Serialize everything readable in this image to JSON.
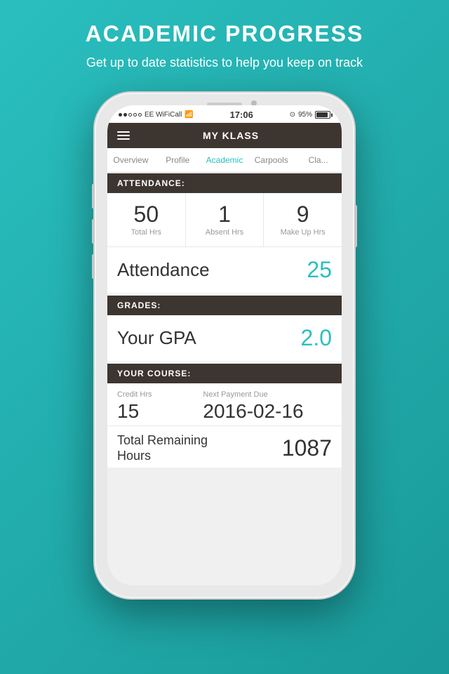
{
  "page": {
    "title": "ACADEMIC PROGRESS",
    "subtitle": "Get up to date statistics to help you keep on track"
  },
  "status_bar": {
    "carrier": "●●○○○ EE WiFiCall",
    "wifi": "WiFiCall",
    "time": "17:06",
    "battery_pct": "95%",
    "location_icon": "⊙"
  },
  "app": {
    "title": "MY KLASS",
    "menu_label": "menu"
  },
  "tabs": [
    {
      "id": "overview",
      "label": "Overview",
      "active": false
    },
    {
      "id": "profile",
      "label": "Profile",
      "active": false
    },
    {
      "id": "academic",
      "label": "Academic",
      "active": true
    },
    {
      "id": "carpools",
      "label": "Carpools",
      "active": false
    },
    {
      "id": "cla",
      "label": "Cla...",
      "active": false
    }
  ],
  "attendance_section": {
    "header": "ATTENDANCE:",
    "stats": [
      {
        "value": "50",
        "label": "Total Hrs"
      },
      {
        "value": "1",
        "label": "Absent Hrs"
      },
      {
        "value": "9",
        "label": "Make Up Hrs"
      }
    ],
    "summary_label": "Attendance",
    "summary_value": "25"
  },
  "grades_section": {
    "header": "GRADES:",
    "gpa_label": "Your GPA",
    "gpa_value": "2.0"
  },
  "course_section": {
    "header": "YOUR COURSE:",
    "credit_hrs_label": "Credit Hrs",
    "credit_hrs_value": "15",
    "next_payment_label": "Next Payment Due",
    "next_payment_value": "2016-02-16",
    "total_remaining_label": "Total Remaining\nHours",
    "total_remaining_value": "1087"
  }
}
